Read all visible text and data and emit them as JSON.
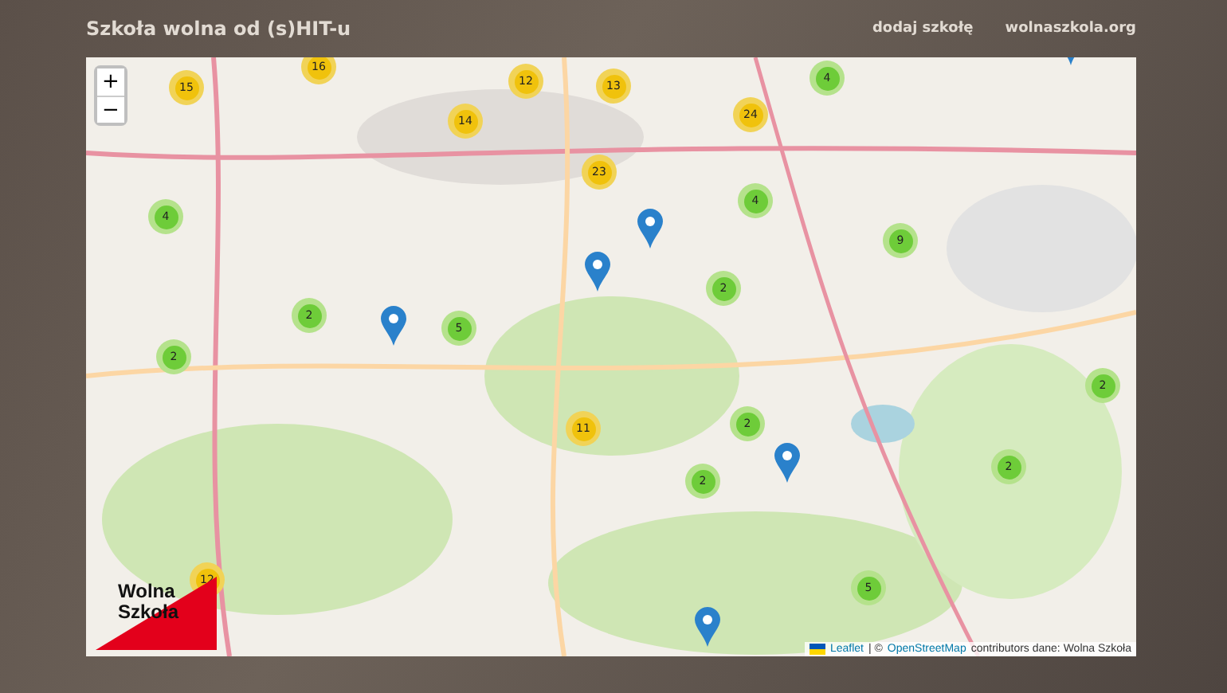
{
  "header": {
    "title": "Szkoła wolna od (s)HIT-u",
    "links": [
      "dodaj szkołę",
      "wolnaszkola.org"
    ]
  },
  "map": {
    "zoom_in": "+",
    "zoom_out": "−",
    "clusters": [
      {
        "count": "16",
        "color": "#f1d357"
      },
      {
        "count": "15",
        "color": "#f1d357"
      },
      {
        "count": "12",
        "color": "#f1d357"
      },
      {
        "count": "13",
        "color": "#f1d357"
      },
      {
        "count": "4",
        "color": "#b5e28c"
      },
      {
        "count": "14",
        "color": "#f1d357"
      },
      {
        "count": "24",
        "color": "#f1d357"
      },
      {
        "count": "23",
        "color": "#f1d357"
      },
      {
        "count": "4",
        "color": "#b5e28c"
      },
      {
        "count": "4",
        "color": "#b5e28c"
      },
      {
        "count": "9",
        "color": "#b5e28c"
      },
      {
        "count": "2",
        "color": "#b5e28c"
      },
      {
        "count": "2",
        "color": "#b5e28c"
      },
      {
        "count": "5",
        "color": "#b5e28c"
      },
      {
        "count": "2",
        "color": "#b5e28c"
      },
      {
        "count": "2",
        "color": "#b5e28c"
      },
      {
        "count": "11",
        "color": "#f1d357"
      },
      {
        "count": "2",
        "color": "#b5e28c"
      },
      {
        "count": "2",
        "color": "#b5e28c"
      },
      {
        "count": "2",
        "color": "#b5e28c"
      },
      {
        "count": "12",
        "color": "#f1d357"
      },
      {
        "count": "5",
        "color": "#b5e28c"
      }
    ],
    "logo": {
      "line_1": "Wolna",
      "line_2": "Szkoła"
    },
    "attribution": {
      "leaflet": "Leaflet",
      "separator": "| ©",
      "osm": "OpenStreetMap",
      "rest": "contributors dane: Wolna Szkoła"
    }
  }
}
